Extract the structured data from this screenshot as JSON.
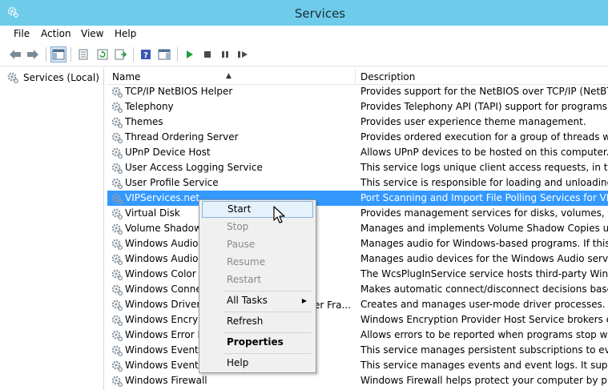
{
  "window": {
    "title": "Services"
  },
  "menu": [
    "File",
    "Action",
    "View",
    "Help"
  ],
  "tree": {
    "root_label": "Services (Local)"
  },
  "columns": {
    "name": "Name",
    "description": "Description"
  },
  "services": [
    {
      "name": "TCP/IP NetBIOS Helper",
      "description": "Provides support for the NetBIOS over TCP/IP (NetBT) ser..."
    },
    {
      "name": "Telephony",
      "description": "Provides Telephony API (TAPI) support for programs tha..."
    },
    {
      "name": "Themes",
      "description": "Provides user experience theme management."
    },
    {
      "name": "Thread Ordering Server",
      "description": "Provides ordered execution for a group of threads within ..."
    },
    {
      "name": "UPnP Device Host",
      "description": "Allows UPnP devices to be hosted on this computer. If th..."
    },
    {
      "name": "User Access Logging Service",
      "description": "This service logs unique client access requests, in the for..."
    },
    {
      "name": "User Profile Service",
      "description": "This service is responsible for loading and unloading use..."
    },
    {
      "name": "VIPServices.net",
      "description": "Port Scanning and Import File Polling Services for VIP.net."
    },
    {
      "name": "Virtual Disk",
      "description": "Provides management services for disks, volumes, file sy..."
    },
    {
      "name": "Volume Shadow C",
      "description": "Manages and implements Volume Shadow Copies used f..."
    },
    {
      "name": "Windows Audio",
      "description": "Manages audio for Windows-based programs.  If this ser..."
    },
    {
      "name": "Windows Audio E",
      "description": "Manages audio devices for the Windows Audio service.  I..."
    },
    {
      "name": "Windows Color Sy",
      "description": "The WcsPlugInService service hosts third-party Windows..."
    },
    {
      "name": "Windows Connec",
      "description": "Makes automatic connect/disconnect decisions based o..."
    },
    {
      "name": "Windows Driver F",
      "description": "Creates and manages user-mode driver processes. This s..."
    },
    {
      "name": "Windows Encrypt",
      "description": "Windows Encryption Provider Host Service brokers encry..."
    },
    {
      "name": "Windows Error Re",
      "description": "Allows errors to be reported when programs stop workin..."
    },
    {
      "name": "Windows Event C",
      "description": "This service manages persistent subscriptions to events f..."
    },
    {
      "name": "Windows Event Lo",
      "description": "This service manages events and event logs. It supports l..."
    },
    {
      "name": "Windows Firewall",
      "description": "Windows Firewall helps protect your computer by preve..."
    }
  ],
  "driver_row_overflow": "er Fra...",
  "context_menu": {
    "start": "Start",
    "stop": "Stop",
    "pause": "Pause",
    "resume": "Resume",
    "restart": "Restart",
    "all_tasks": "All Tasks",
    "refresh": "Refresh",
    "properties": "Properties",
    "help": "Help"
  },
  "colors": {
    "titlebar": "#6ecbea",
    "selection": "#3399ff",
    "play": "#1e9e3a"
  }
}
